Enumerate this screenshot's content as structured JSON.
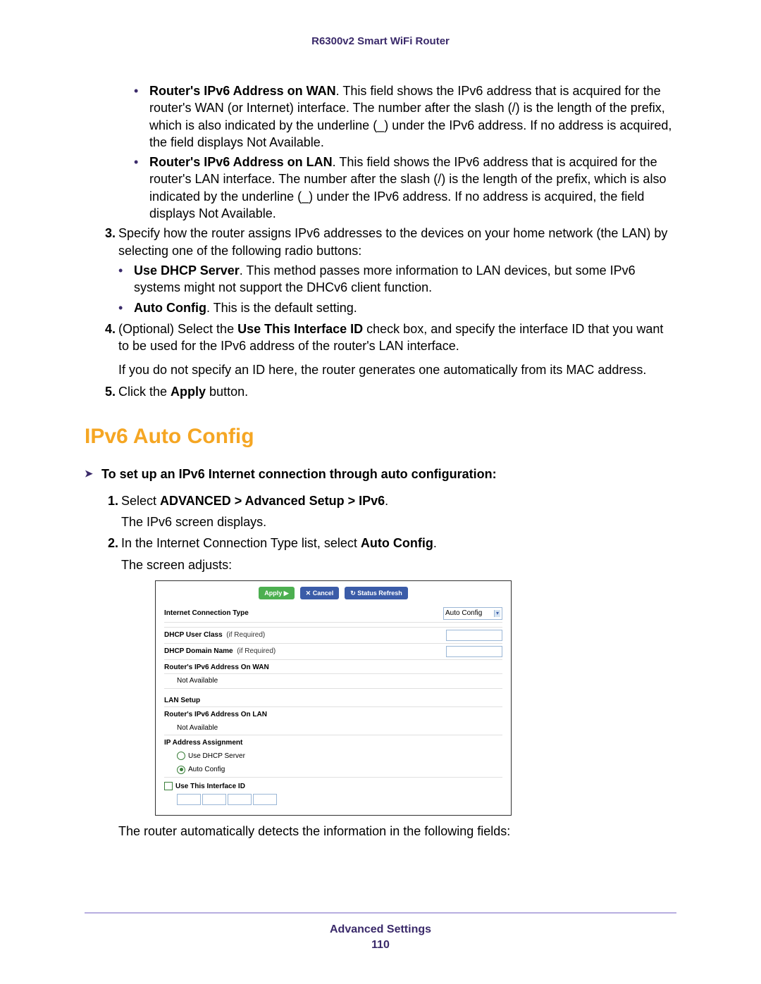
{
  "header": {
    "product": "R6300v2 Smart WiFi Router"
  },
  "content": {
    "bullets_top": [
      {
        "bold": "Router's IPv6 Address on WAN",
        "text": ". This field shows the IPv6 address that is acquired for the router's WAN (or Internet) interface. The number after the slash (/) is the length of the prefix, which is also indicated by the underline (_) under the IPv6 address. If no address is acquired, the field displays Not Available."
      },
      {
        "bold": "Router's IPv6 Address on LAN",
        "text": ". This field shows the IPv6 address that is acquired for the router's LAN interface. The number after the slash (/) is the length of the prefix, which is also indicated by the underline (_) under the IPv6 address. If no address is acquired, the field displays Not Available."
      }
    ],
    "step3": {
      "marker": "3.",
      "text": "Specify how the router assigns IPv6 addresses to the devices on your home network (the LAN) by selecting one of the following radio buttons:",
      "bullets": [
        {
          "bold": "Use DHCP Server",
          "text": ". This method passes more information to LAN devices, but some IPv6 systems might not support the DHCv6 client function."
        },
        {
          "bold": "Auto Config",
          "text": ". This is the default setting."
        }
      ]
    },
    "step4": {
      "marker": "4.",
      "pre": "(Optional) Select the ",
      "bold": "Use This Interface ID",
      "post": " check box, and specify the interface ID that you want to be used for the IPv6 address of the router's LAN interface.",
      "note": "If you do not specify an ID here, the router generates one automatically from its MAC address."
    },
    "step5": {
      "marker": "5.",
      "pre": "Click the ",
      "bold": "Apply",
      "post": " button."
    },
    "heading": "IPv6 Auto Config",
    "task": "To set up an IPv6 Internet connection through auto configuration:",
    "sec_step1": {
      "marker": "1.",
      "pre": "Select ",
      "bold": "ADVANCED > Advanced Setup > IPv6",
      "post": ".",
      "after": "The IPv6 screen displays."
    },
    "sec_step2": {
      "marker": "2.",
      "pre": "In the Internet Connection Type list, select ",
      "bold": "Auto Config",
      "post": ".",
      "after": "The screen adjusts:"
    },
    "closing": "The router automatically detects the information in the following fields:"
  },
  "shot": {
    "buttons": {
      "apply": "Apply ▶",
      "cancel": "✕ Cancel",
      "refresh": "↻ Status Refresh"
    },
    "conn_type_label": "Internet Connection Type",
    "conn_type_value": "Auto Config",
    "dhcp_user_class": "DHCP User Class",
    "if_required": "(if Required)",
    "dhcp_domain": "DHCP Domain Name",
    "wan_addr_label": "Router's IPv6 Address On WAN",
    "not_available": "Not Available",
    "lan_setup": "LAN Setup",
    "lan_addr_label": "Router's IPv6 Address On LAN",
    "ip_assign": "IP Address Assignment",
    "use_dhcp": "Use DHCP Server",
    "auto_config": "Auto Config",
    "use_iface": "Use This Interface ID"
  },
  "footer": {
    "section": "Advanced Settings",
    "page": "110"
  }
}
